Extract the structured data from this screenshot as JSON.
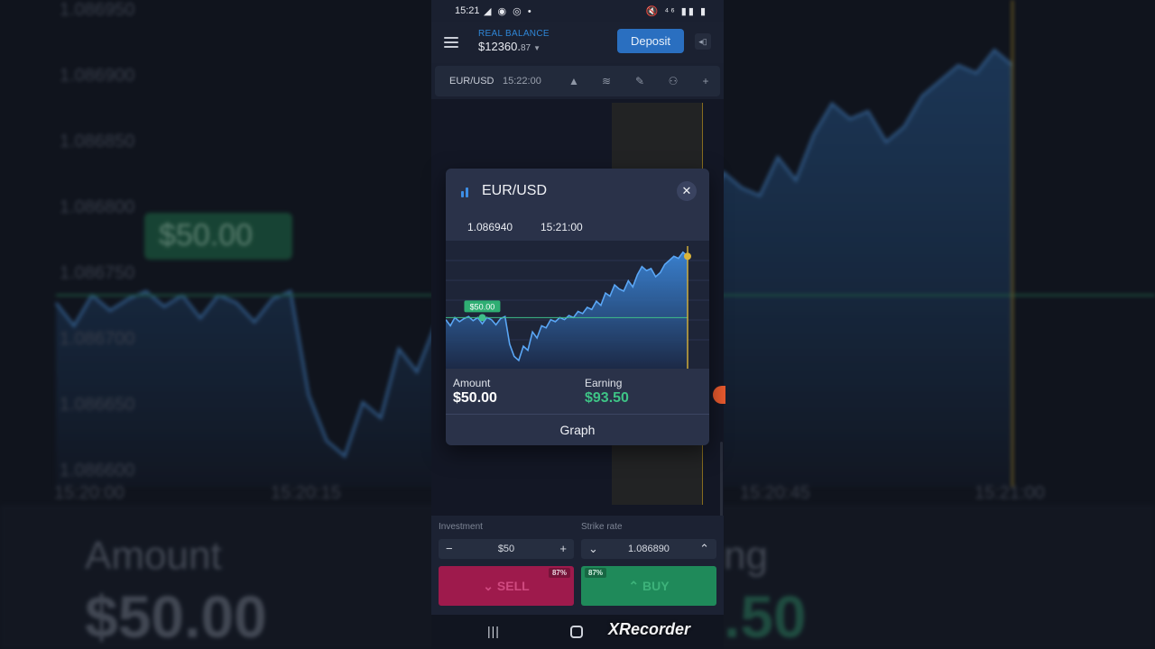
{
  "background": {
    "y_ticks": [
      "1.086950",
      "1.086900",
      "1.086850",
      "1.086800",
      "1.086750",
      "1.086700",
      "1.086650",
      "1.086600"
    ],
    "x_ticks": [
      "15:20:00",
      "15:20:15",
      "15:20:45",
      "15:21:00"
    ],
    "badge": "$50.00",
    "amount_label": "Amount",
    "amount_value": "$50.00",
    "earning_label_fragment": "ng",
    "earning_value_fragment": ".50"
  },
  "status_bar": {
    "time": "15:21",
    "left_icons": "◢ ◉ ◎ •",
    "right_icons": "🔇 ⁴⁶ ▮▮ ▮"
  },
  "header": {
    "balance_label": "REAL BALANCE",
    "balance_main": "$12360.",
    "balance_cents": "87",
    "balance_caret": "▼",
    "deposit_label": "Deposit",
    "exit_glyph": "◂▯"
  },
  "toolbar": {
    "pair": "EUR/USD",
    "time": "15:22:00",
    "icons": {
      "chart_type": "▲",
      "indicators": "≋",
      "draw": "✎",
      "social": "⚇",
      "add": "+"
    }
  },
  "trade": {
    "investment_label": "Investment",
    "investment_value": "$50",
    "minus": "−",
    "plus": "+",
    "strike_label": "Strike rate",
    "strike_value": "1.086890",
    "strike_down": "⌄",
    "strike_up": "⌃",
    "sell_label": "SELL",
    "buy_label": "BUY",
    "sell_payout": "87%",
    "buy_payout": "87%"
  },
  "navbar": {
    "recent": "|||",
    "watermark": "XRecorder"
  },
  "modal": {
    "title": "EUR/USD",
    "close": "✕",
    "price": "1.086940",
    "time": "15:21:00",
    "badge": "$50.00",
    "amount_label": "Amount",
    "amount_value": "$50.00",
    "earning_label": "Earning",
    "earning_value": "$93.50",
    "graph_button": "Graph"
  },
  "colors": {
    "accent_blue": "#2a6fc0",
    "sell_red": "#9e1a4c",
    "buy_green": "#1f8a5a",
    "earning_green": "#3ec486",
    "strike_gold": "#c9a227",
    "modal_bg": "#2a3249"
  },
  "chart_data": {
    "type": "area",
    "series": [
      {
        "values": [
          1.086878,
          1.086872,
          1.08688,
          1.086876,
          1.086879,
          1.086881,
          1.086877,
          1.08688,
          1.086874,
          1.08688,
          1.086878,
          1.086873,
          1.086879,
          1.086881,
          1.086854,
          1.086842,
          1.086838,
          1.086852,
          1.086848,
          1.086866,
          1.08686,
          1.086872,
          1.08687,
          1.086878,
          1.086876,
          1.08688,
          1.086878,
          1.086882,
          1.08688,
          1.086886,
          1.086884,
          1.08689,
          1.086888,
          1.086896,
          1.086892,
          1.086904,
          1.086901,
          1.086912,
          1.086908,
          1.086906,
          1.086916,
          1.08691,
          1.086922,
          1.08693,
          1.086926,
          1.086928,
          1.08692,
          1.086924,
          1.086932,
          1.086936,
          1.08694,
          1.086938,
          1.086944,
          1.08694
        ]
      }
    ],
    "strike": 1.08688,
    "ylim": [
      1.08683,
      1.08695
    ],
    "entry_index": 8,
    "strike_marker_label": "$50.00"
  }
}
